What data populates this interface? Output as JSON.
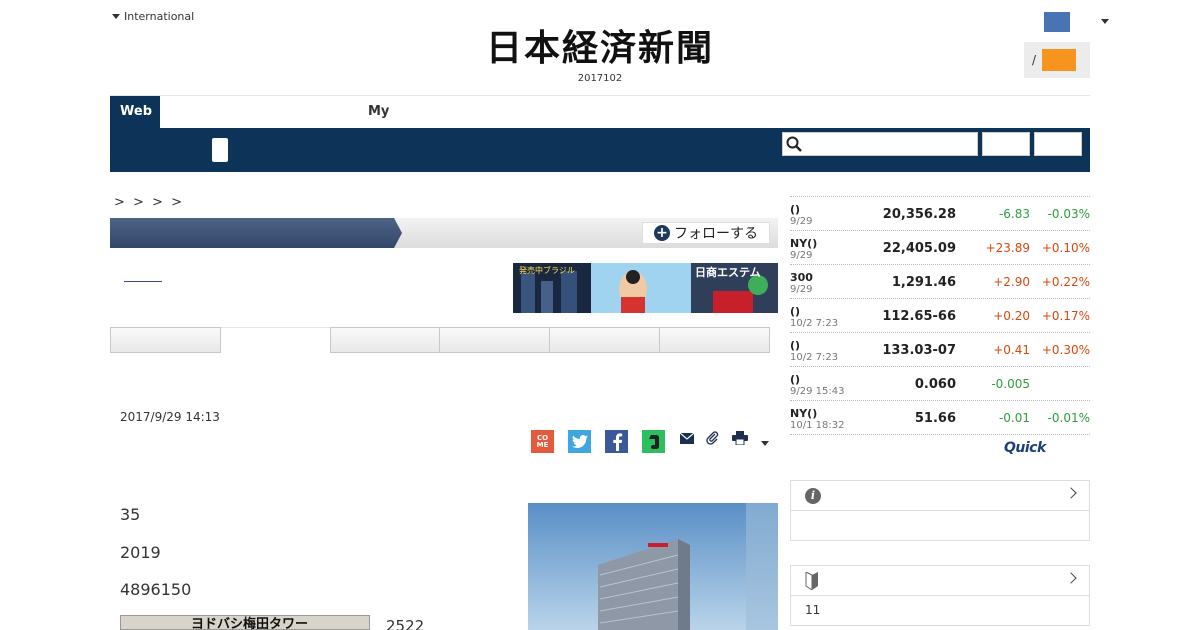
{
  "header": {
    "edition_label": "International",
    "logo_text": "日本経済新聞",
    "date_text": "2017102",
    "login_sep": "/"
  },
  "nav": {
    "web_tab": "Web",
    "my_tab": "My"
  },
  "breadcrumb": "> > > >",
  "section": {
    "follow_label": "フォローする"
  },
  "banner": {
    "left_text": "発売中ブラジル",
    "right_text": "日商エステム"
  },
  "article": {
    "date": "2017/9/29 14:13",
    "para1": "35",
    "para2": "2019",
    "para3": "4896150",
    "map_label": "ヨドバシ梅田タワー",
    "map_caption": "2522",
    "share": {
      "come_label": "COME"
    }
  },
  "market": {
    "rows": [
      {
        "name": "()",
        "time": "9/29",
        "price": "20,356.28",
        "change": "-6.83",
        "pct": "-0.03%",
        "dir": "down"
      },
      {
        "name": "NY()",
        "time": "9/29",
        "price": "22,405.09",
        "change": "+23.89",
        "pct": "+0.10%",
        "dir": "up"
      },
      {
        "name": "300",
        "time": "9/29",
        "price": "1,291.46",
        "change": "+2.90",
        "pct": "+0.22%",
        "dir": "up"
      },
      {
        "name": "()",
        "time": "10/2 7:23",
        "price": "112.65-66",
        "change": "+0.20",
        "pct": "+0.17%",
        "dir": "up"
      },
      {
        "name": "()",
        "time": "10/2 7:23",
        "price": "133.03-07",
        "change": "+0.41",
        "pct": "+0.30%",
        "dir": "up"
      },
      {
        "name": "()",
        "time": "9/29 15:43",
        "price": "0.060",
        "change": "-0.005",
        "pct": "",
        "dir": "down"
      },
      {
        "name": "NY()",
        "time": "10/1 18:32",
        "price": "51.66",
        "change": "-0.01",
        "pct": "-0.01%",
        "dir": "down"
      }
    ],
    "quick_logo": "Quick"
  },
  "boxes": {
    "box2_count": "11"
  },
  "colors": {
    "nav_bg": "#0d3458",
    "up": "#d9480f",
    "down": "#2e9e3e",
    "login_accent": "#f7941d"
  }
}
